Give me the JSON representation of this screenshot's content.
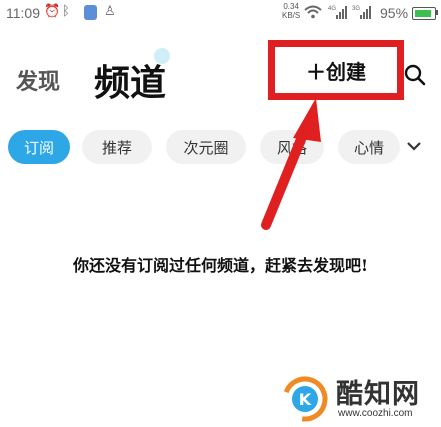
{
  "status_bar": {
    "time": "11:09",
    "net_speed_value": "0.34",
    "net_speed_unit": "KB/S",
    "battery_percent": "95%",
    "icons": [
      "alarm-icon",
      "bluetooth-icon",
      "app-badge-icon",
      "qq-icon",
      "wifi-icon",
      "signal-4g-icon",
      "signal-3g-icon",
      "battery-icon"
    ]
  },
  "header": {
    "tab_discover": "发现",
    "tab_channel": "频道",
    "create_label": "＋创建",
    "search_icon": "search-icon"
  },
  "category_chips": [
    {
      "label": "订阅",
      "active": true
    },
    {
      "label": "推荐",
      "active": false
    },
    {
      "label": "次元圈",
      "active": false
    },
    {
      "label": "风格",
      "active": false
    },
    {
      "label": "心情",
      "active": false
    }
  ],
  "expand_icon": "chevron-down-icon",
  "empty_message": "你还没有订阅过任何频道，赶紧去发现吧!",
  "annotation": {
    "color": "#e02020"
  },
  "watermark": {
    "title": "酷知网",
    "url": "www.coozhi.com"
  },
  "colors": {
    "accent": "#2ea7e6",
    "annotation": "#e02020"
  }
}
